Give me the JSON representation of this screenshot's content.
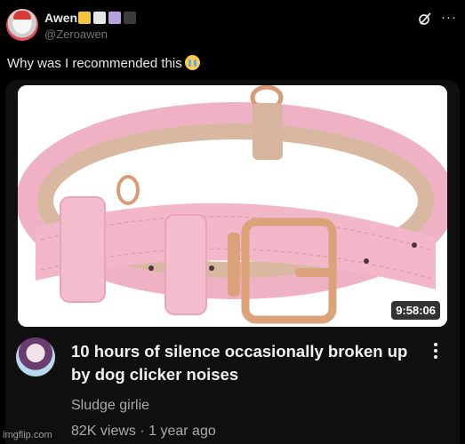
{
  "post": {
    "display_name": "Awen",
    "handle": "@Zeroawen",
    "text": "Why was I recommended this",
    "emoji": "loudly-crying-face-emoji",
    "badge_colors": [
      "#f5c542",
      "#e8e8e8",
      "#b9a2e0",
      "#3b3b3b"
    ],
    "icons": {
      "grok": "grok-icon",
      "more": "more-icon",
      "more_glyph": "···"
    }
  },
  "video": {
    "duration": "9:58:06",
    "title": "10 hours of silence occasionally broken up by dog clicker noises",
    "channel": "Sludge girlie",
    "meta": "82K views · 1 year ago"
  },
  "watermark": "imgflip.com",
  "colors": {
    "background": "#000000",
    "card_background": "#0f0f0f",
    "collar_pink": "#f0b6c8",
    "collar_lining": "#d8b49c",
    "buckle_gold": "#d9a27a"
  }
}
